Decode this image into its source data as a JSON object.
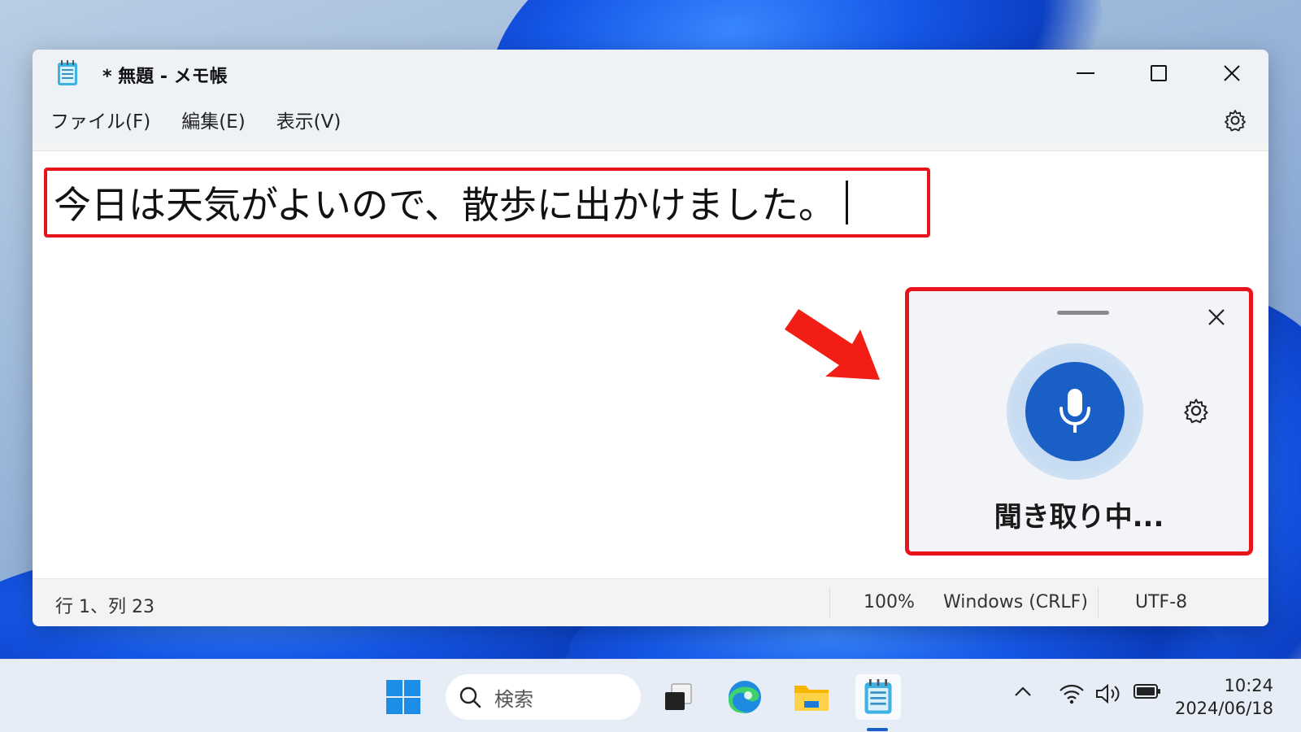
{
  "window": {
    "title": "* 無題 - メモ帳",
    "controls": {
      "minimize": "minimize",
      "maximize": "maximize",
      "close": "close"
    }
  },
  "menu": {
    "items": [
      {
        "label": "ファイル(F)"
      },
      {
        "label": "編集(E)"
      },
      {
        "label": "表示(V)"
      }
    ],
    "settings_icon": "gear-icon"
  },
  "editor": {
    "content": "今日は天気がよいので、散歩に出かけました。"
  },
  "status": {
    "position": "行 1、列 23",
    "zoom": "100%",
    "line_ending": "Windows (CRLF)",
    "encoding": "UTF-8"
  },
  "voice_typing": {
    "status": "聞き取り中...",
    "mic_icon": "microphone-icon",
    "settings_icon": "gear-icon",
    "close_icon": "close-icon"
  },
  "taskbar": {
    "search_placeholder": "検索",
    "apps": [
      "start-icon",
      "task-view-icon",
      "edge-icon",
      "file-explorer-icon",
      "notepad-icon"
    ],
    "tray": [
      "chevron-up-icon",
      "wifi-icon",
      "volume-icon",
      "battery-icon"
    ],
    "time": "10:24",
    "date": "2024/06/18"
  },
  "colors": {
    "highlight_red": "#e8141c",
    "accent_blue": "#1a5fc6"
  }
}
